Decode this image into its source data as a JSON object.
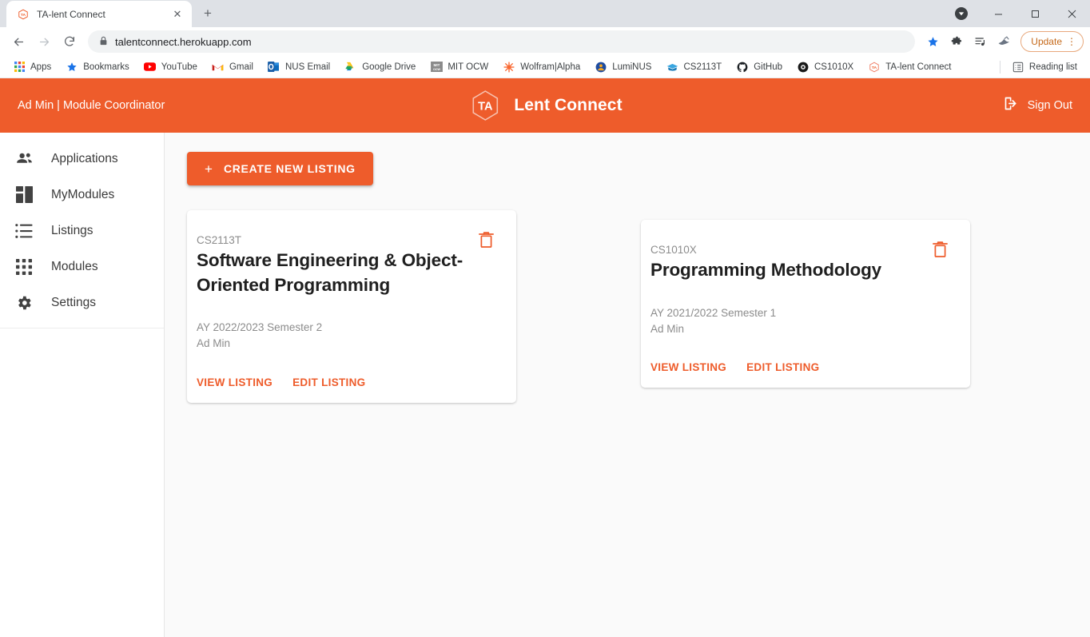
{
  "browser": {
    "tab": {
      "title": "TA-lent Connect",
      "favicon": "ta-logo-icon",
      "close": "✕"
    },
    "new_tab_label": "+",
    "window_controls": {
      "download": "▼",
      "minimize": "–",
      "maximize": "❐",
      "close": "✕"
    },
    "nav": {
      "back": "←",
      "forward": "→",
      "reload": "↻"
    },
    "omnibox": {
      "lock": "🔒",
      "url": "talentconnect.herokuapp.com"
    },
    "toolbar_icons": {
      "star": "★",
      "extensions": "🧩",
      "playlist": "≡",
      "profile": "👤"
    },
    "update": {
      "label": "Update",
      "menu": "⋮"
    },
    "bookmarks": [
      {
        "label": "Apps",
        "icon": "apps-grid-icon"
      },
      {
        "label": "Bookmarks",
        "icon": "star-icon"
      },
      {
        "label": "YouTube",
        "icon": "youtube-icon"
      },
      {
        "label": "Gmail",
        "icon": "gmail-icon"
      },
      {
        "label": "NUS Email",
        "icon": "outlook-icon"
      },
      {
        "label": "Google Drive",
        "icon": "drive-icon"
      },
      {
        "label": "MIT OCW",
        "icon": "mit-ocw-icon"
      },
      {
        "label": "Wolfram|Alpha",
        "icon": "wolfram-icon"
      },
      {
        "label": "LumiNUS",
        "icon": "luminus-icon"
      },
      {
        "label": "CS2113T",
        "icon": "cs2113t-icon"
      },
      {
        "label": "GitHub",
        "icon": "github-icon"
      },
      {
        "label": "CS1010X",
        "icon": "cs1010x-icon"
      },
      {
        "label": "TA-lent Connect",
        "icon": "ta-logo-icon"
      }
    ],
    "reading_list": {
      "label": "Reading list",
      "icon": "reading-list-icon"
    }
  },
  "app": {
    "accent_color": "#ee5c2b",
    "user_line": "Ad Min | Module Coordinator",
    "brand": {
      "mark": "TA",
      "name": "Lent Connect"
    },
    "sign_out": {
      "label": "Sign Out",
      "icon": "sign-out-icon"
    }
  },
  "sidebar": {
    "items": [
      {
        "label": "Applications",
        "icon": "people-icon"
      },
      {
        "label": "MyModules",
        "icon": "dashboard-icon"
      },
      {
        "label": "Listings",
        "icon": "list-icon"
      },
      {
        "label": "Modules",
        "icon": "apps-grid-icon"
      },
      {
        "label": "Settings",
        "icon": "gear-icon"
      }
    ]
  },
  "main": {
    "create_button": {
      "plus": "+",
      "label": "CREATE NEW LISTING"
    },
    "links": {
      "view": "VIEW LISTING",
      "edit": "EDIT LISTING"
    },
    "delete_icon": "trash-icon",
    "cards": [
      {
        "code": "CS2113T",
        "title": "Software Engineering & Object-Oriented Programming",
        "term": "AY 2022/2023 Semester 2",
        "owner": "Ad Min"
      },
      {
        "code": "CS1010X",
        "title": "Programming Methodology",
        "term": "AY 2021/2022 Semester 1",
        "owner": "Ad Min"
      }
    ]
  }
}
